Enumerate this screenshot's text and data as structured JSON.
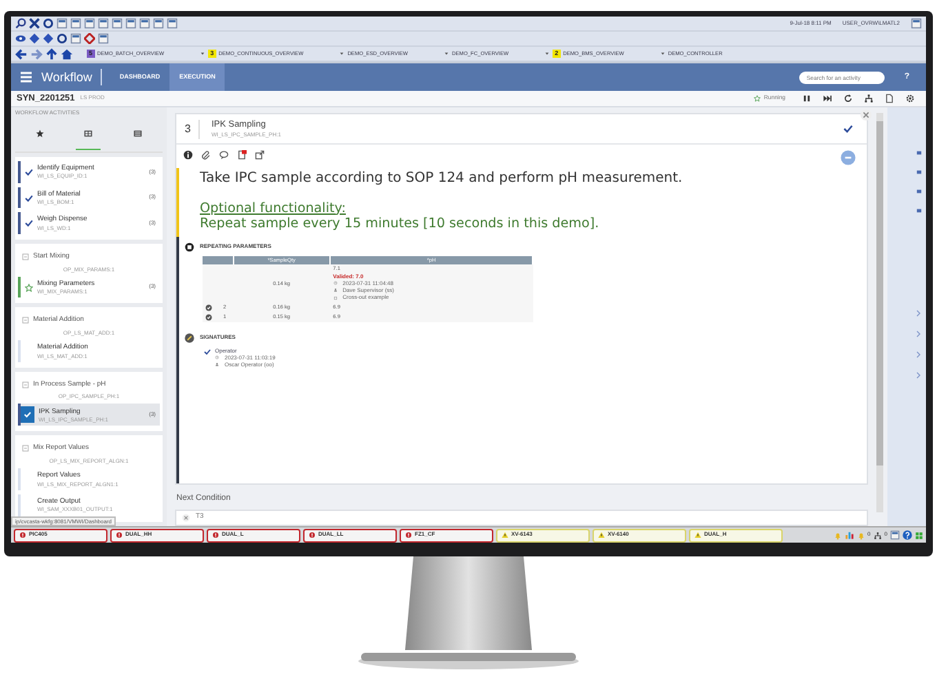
{
  "toolbar": {
    "datetime": "9-Jul-18 8:11 PM",
    "user": "USER_OVRW\\LMATL2"
  },
  "display_tabs": [
    {
      "label": "DEMO_BATCH_OVERVIEW",
      "badge": "5",
      "color": "#7b5cc4"
    },
    {
      "label": "DEMO_CONTINUOUS_OVERVIEW",
      "badge": "3",
      "color": "#f2e600"
    },
    {
      "label": "DEMO_ESD_OVERVIEW"
    },
    {
      "label": "DEMO_FC_OVERVIEW"
    },
    {
      "label": "DEMO_BMS_OVERVIEW",
      "badge": "2",
      "color": "#f2e600"
    },
    {
      "label": "DEMO_CONTROLLER"
    }
  ],
  "app": {
    "title": "Workflow",
    "nav": [
      {
        "label": "DASHBOARD",
        "selected": false
      },
      {
        "label": "EXECUTION",
        "selected": true
      }
    ],
    "search": {
      "placeholder": "Search for an activity"
    },
    "help": "?"
  },
  "order": {
    "id": "SYN_2201251",
    "area": "LS PROD",
    "status": "Running"
  },
  "sidebar": {
    "title": "WORKFLOW ACTIVITIES",
    "tabs": [
      {
        "selected": false
      },
      {
        "selected": true
      },
      {
        "selected": false
      }
    ],
    "items": [
      {
        "kind": "group",
        "children": [
          {
            "name": "Identify Equipment",
            "code": "WI_LS_EQUIP_ID:1",
            "count": "(3)",
            "done": true,
            "running": false,
            "selected": false
          },
          {
            "name": "Bill of Material",
            "code": "WI_LS_BOM:1",
            "count": "(3)",
            "done": true,
            "running": false,
            "selected": false
          },
          {
            "name": "Weigh Dispense",
            "code": "WI_LS_WD:1",
            "count": "(3)",
            "done": true,
            "running": false,
            "selected": false
          }
        ]
      },
      {
        "kind": "group",
        "name": "Start Mixing",
        "code": "OP_MIX_PARAMS:1",
        "children": [
          {
            "name": "Mixing Parameters",
            "code": "WI_MIX_PARAMS:1",
            "count": "(3)",
            "done": false,
            "running": true,
            "selected": false
          }
        ]
      },
      {
        "kind": "group",
        "name": "Material Addition",
        "code": "OP_LS_MAT_ADD:1",
        "children": [
          {
            "name": "Material Addition",
            "code": "WI_LS_MAT_ADD:1",
            "done": false,
            "running": false,
            "selected": false
          }
        ]
      },
      {
        "kind": "group",
        "name": "In Process Sample - pH",
        "code": "OP_IPC_SAMPLE_PH:1",
        "children": [
          {
            "name": "IPK Sampling",
            "code": "WI_LS_IPC_SAMPLE_PH:1",
            "count": "(3)",
            "done": true,
            "running": false,
            "selected": true
          }
        ]
      },
      {
        "kind": "group",
        "name": "Mix Report Values",
        "code": "OP_LS_MIX_REPORT_ALGN:1",
        "children": [
          {
            "name": "Report Values",
            "code": "WI_LS_MIX_REPORT_ALGN1:1",
            "done": false,
            "running": false,
            "selected": false
          },
          {
            "name": "Create Output",
            "code": "WI_SAM_XXXB01_OUTPUT:1",
            "done": false,
            "running": false,
            "selected": false
          }
        ]
      }
    ],
    "url": "ip/cvcasta-wkfg:8081/VMWI/Dashboard"
  },
  "step": {
    "number": "3",
    "title": "IPK Sampling",
    "code": "WI_LS_IPC_SAMPLE_PH:1",
    "done": true,
    "instruction": "Take IPC sample according to SOP 124 and perform pH measurement.",
    "optional_heading": "Optional functionality:",
    "optional_text": "Repeat sample every 15 minutes [10 seconds in this demo].",
    "repeating_parameters": {
      "title": "REPEATING PARAMETERS",
      "columns": [
        "*SampleQty",
        "*pH"
      ],
      "rows": [
        {
          "index": "",
          "qty": "0.14 kg",
          "ph": "7.1",
          "validation": {
            "label": "Valided: 7.0",
            "time": "2023-07-31 11:04:48",
            "user": "Dave Supervisor (ss)",
            "note": "Cross-out example"
          }
        },
        {
          "index": "2",
          "qty": "0.16 kg",
          "ph": "6.9"
        },
        {
          "index": "1",
          "qty": "0.15 kg",
          "ph": "6.9"
        }
      ]
    },
    "signatures": {
      "title": "SIGNATURES",
      "items": [
        {
          "role": "Operator",
          "signed": true,
          "time": "2023-07-31 11:03:19",
          "user": "Oscar Operator (oo)"
        }
      ]
    }
  },
  "next_condition": {
    "title": "Next Condition",
    "label": "T3"
  },
  "alarms": [
    {
      "tag": "PIC405",
      "kind": "error"
    },
    {
      "tag": "DUAL_HH",
      "kind": "error"
    },
    {
      "tag": "DUAL_L",
      "kind": "error"
    },
    {
      "tag": "DUAL_LL",
      "kind": "error"
    },
    {
      "tag": "FZ1_CF",
      "kind": "error"
    },
    {
      "tag": "XV-6143",
      "kind": "warning"
    },
    {
      "tag": "XV-6140",
      "kind": "warning"
    },
    {
      "tag": "DUAL_H",
      "kind": "warning"
    }
  ],
  "tray": {
    "count_a": "0",
    "count_b": "0"
  }
}
